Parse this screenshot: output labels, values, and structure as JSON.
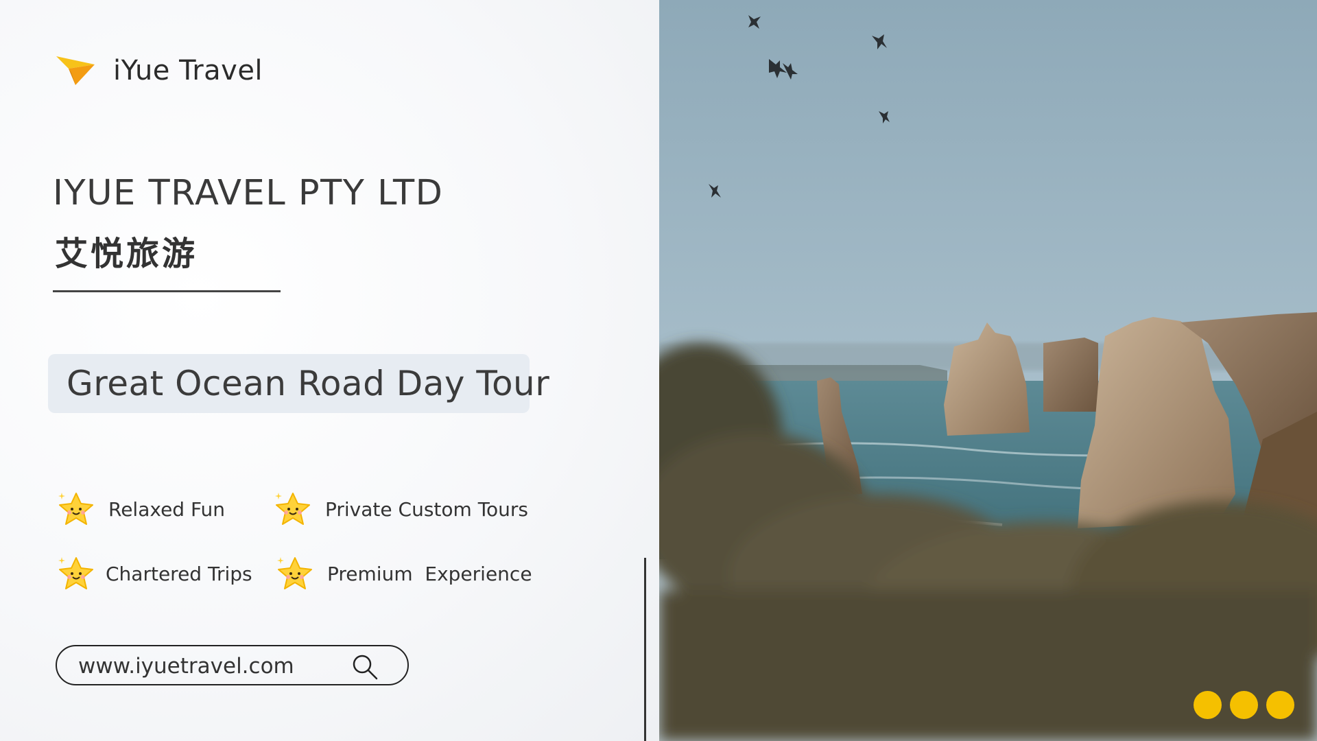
{
  "brand": {
    "name": "iYue Travel",
    "logo_icon": "paper-plane-icon",
    "accent_color": "#f5b800"
  },
  "company": {
    "name_en": "IYUE TRAVEL PTY LTD",
    "name_cn": "艾悦旅游"
  },
  "tour": {
    "title": "Great Ocean Road Day Tour"
  },
  "features": [
    {
      "label": "Relaxed Fun",
      "icon": "smiling-star-icon"
    },
    {
      "label": "Private Custom Tours",
      "icon": "smiling-star-icon"
    },
    {
      "label": "Chartered Trips",
      "icon": "smiling-star-icon"
    },
    {
      "label": "Premium  Experience",
      "icon": "smiling-star-icon"
    }
  ],
  "website": {
    "url": "www.iyuetravel.com",
    "icon": "search-icon"
  },
  "carousel": {
    "dot_count": 3,
    "dot_color": "#f5c000"
  },
  "photo": {
    "subject_icon": "coastal-photo"
  }
}
